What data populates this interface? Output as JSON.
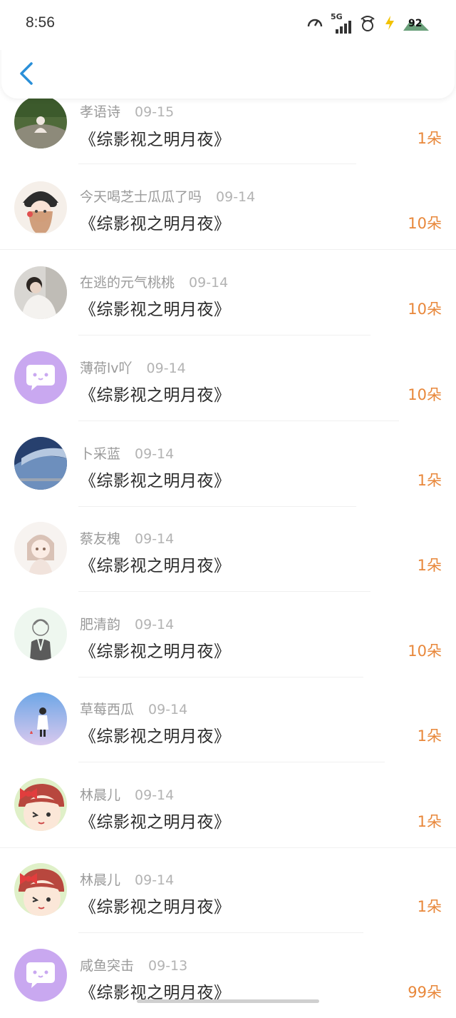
{
  "status_bar": {
    "time": "8:56",
    "network": "5G",
    "battery": "92"
  },
  "rows": [
    {
      "name": "孝语诗",
      "date": "09-15",
      "title": "《综影视之明月夜》",
      "count": "1朵",
      "avatar": "photo-garden"
    },
    {
      "name": "今天喝芝士瓜瓜了吗",
      "date": "09-14",
      "title": "《综影视之明月夜》",
      "count": "10朵",
      "avatar": "cartoon-girl-hat"
    },
    {
      "name": "在逃的元气桃桃",
      "date": "09-14",
      "title": "《综影视之明月夜》",
      "count": "10朵",
      "avatar": "photo-person"
    },
    {
      "name": "薄荷lv吖",
      "date": "09-14",
      "title": "《综影视之明月夜》",
      "count": "10朵",
      "avatar": "default-chat-bubble"
    },
    {
      "name": "卜采蓝",
      "date": "09-14",
      "title": "《综影视之明月夜》",
      "count": "1朵",
      "avatar": "photo-sky"
    },
    {
      "name": "蔡友槐",
      "date": "09-14",
      "title": "《综影视之明月夜》",
      "count": "1朵",
      "avatar": "sketch-girl"
    },
    {
      "name": "肥清韵",
      "date": "09-14",
      "title": "《综影视之明月夜》",
      "count": "10朵",
      "avatar": "sketch-boy"
    },
    {
      "name": "草莓西瓜",
      "date": "09-14",
      "title": "《综影视之明月夜》",
      "count": "1朵",
      "avatar": "illustration-sky"
    },
    {
      "name": "林晨儿",
      "date": "09-14",
      "title": "《综影视之明月夜》",
      "count": "1朵",
      "avatar": "cartoon-bow"
    },
    {
      "name": "林晨儿",
      "date": "09-14",
      "title": "《综影视之明月夜》",
      "count": "1朵",
      "avatar": "cartoon-bow"
    },
    {
      "name": "咸鱼突击",
      "date": "09-13",
      "title": "《综影视之明月夜》",
      "count": "99朵",
      "avatar": "default-chat-bubble"
    }
  ],
  "colors": {
    "accent": "#e8873a",
    "back": "#2a8fd8",
    "default_avatar": "#c9a8f0"
  }
}
